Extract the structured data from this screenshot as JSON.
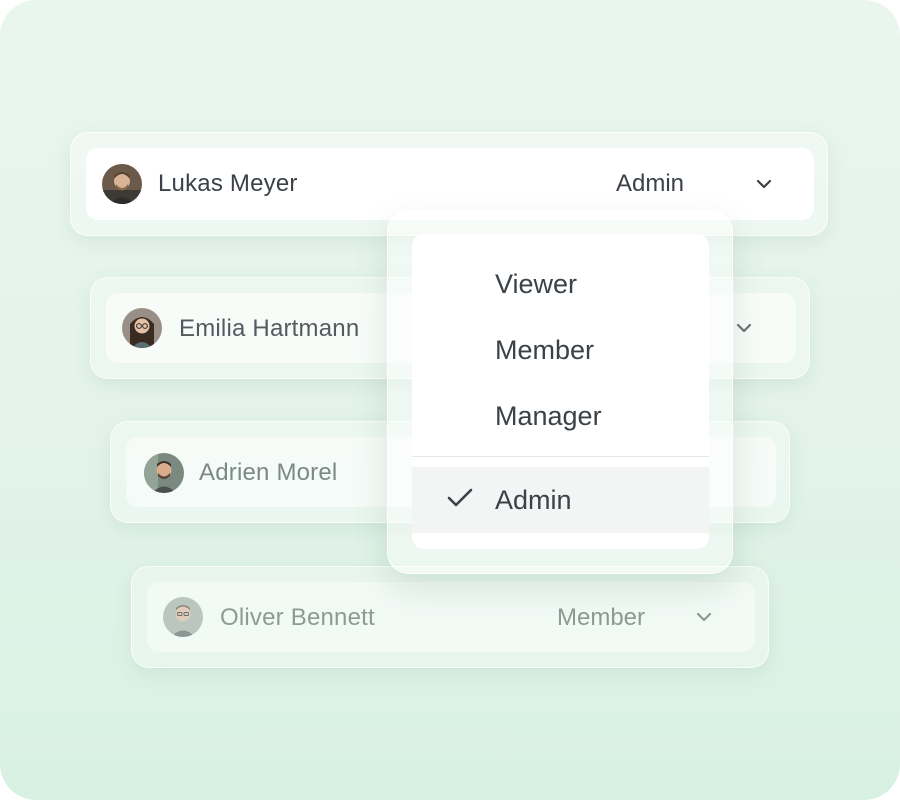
{
  "members": [
    {
      "name": "Lukas Meyer",
      "role": "Admin"
    },
    {
      "name": "Emilia Hartmann",
      "role": ""
    },
    {
      "name": "Adrien Morel",
      "role": ""
    },
    {
      "name": "Oliver Bennett",
      "role": "Member"
    }
  ],
  "role_menu": {
    "options": [
      "Viewer",
      "Member",
      "Manager",
      "Admin"
    ],
    "selected": "Admin"
  },
  "colors": {
    "background_top": "#e9f6ee",
    "background_bottom": "#d8f1e2",
    "text_primary": "#3b4148",
    "text_faded": "#8a9a90"
  }
}
